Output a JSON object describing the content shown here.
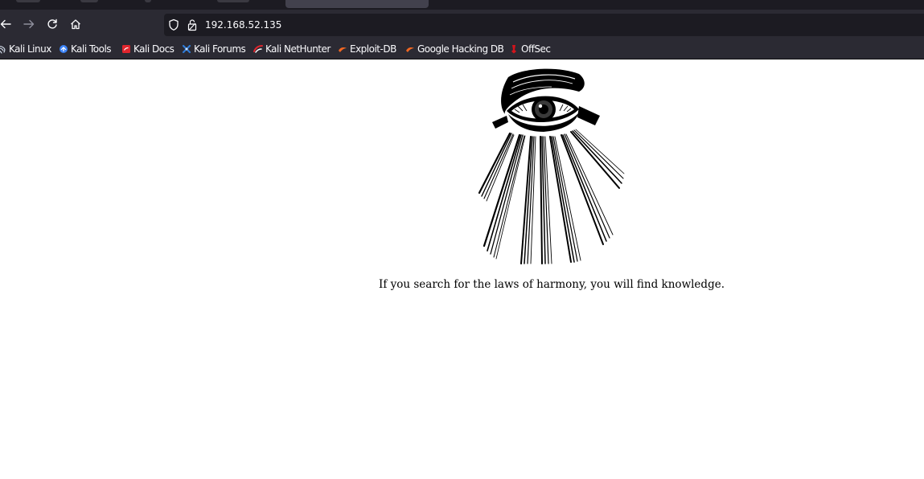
{
  "browser": {
    "url": "192.168.52.135",
    "nav": {
      "back_icon": "arrow-left-icon",
      "forward_icon": "arrow-right-icon",
      "reload_icon": "reload-icon",
      "home_icon": "home-icon"
    },
    "url_icons": [
      "shield-icon",
      "lock-icon"
    ],
    "bookmarks": [
      {
        "label": "Kali Linux",
        "icon": "kali-dragon-icon",
        "color": "#3b82f6"
      },
      {
        "label": "Kali Tools",
        "icon": "kali-tools-icon",
        "color": "#3b82f6"
      },
      {
        "label": "Kali Docs",
        "icon": "kali-docs-icon",
        "color": "#e0252d"
      },
      {
        "label": "Kali Forums",
        "icon": "kali-forums-icon",
        "color": "#2f7bd6"
      },
      {
        "label": "Kali NetHunter",
        "icon": "nethunter-icon",
        "color": "#e0252d"
      },
      {
        "label": "Exploit-DB",
        "icon": "exploit-db-icon",
        "color": "#f26722"
      },
      {
        "label": "Google Hacking DB",
        "icon": "ghdb-icon",
        "color": "#f26722"
      },
      {
        "label": "OffSec",
        "icon": "offsec-icon",
        "color": "#d2141c"
      }
    ]
  },
  "page": {
    "image": "all-seeing-eye-illustration",
    "caption": "If you search for the laws of harmony, you will find knowledge."
  },
  "colors": {
    "chrome_background": "#2b2a33",
    "urlbar_background": "#1c1b22",
    "page_background": "#ffffff"
  }
}
